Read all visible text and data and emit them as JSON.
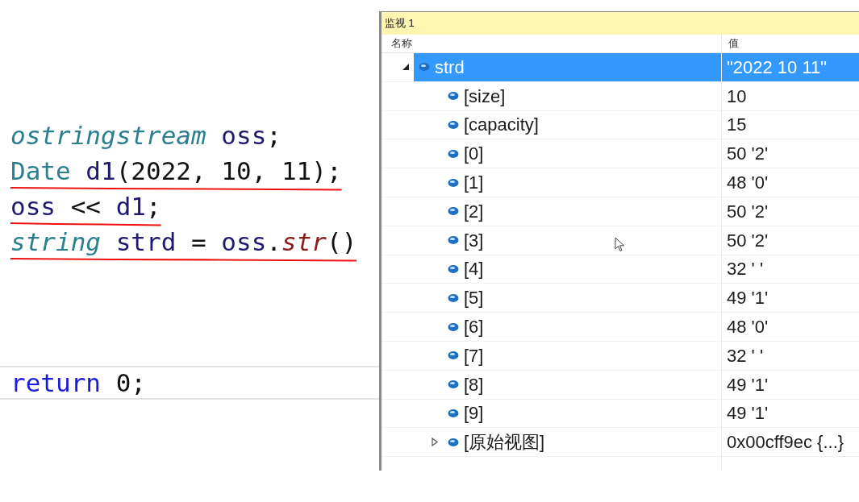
{
  "code_lines": [
    {
      "underlined": false,
      "current": false,
      "tokens": [
        {
          "kind": "type",
          "text": "ostringstream"
        },
        {
          "kind": "variable",
          "text": " oss"
        },
        {
          "kind": "punct",
          "text": ";"
        }
      ]
    },
    {
      "underlined": true,
      "current": false,
      "tokens": [
        {
          "kind": "class",
          "text": "Date"
        },
        {
          "kind": "variable",
          "text": " d1"
        },
        {
          "kind": "punct",
          "text": "(2022, 10, 11);"
        }
      ]
    },
    {
      "underlined": true,
      "current": false,
      "tokens": [
        {
          "kind": "variable",
          "text": "oss"
        },
        {
          "kind": "punct",
          "text": " << "
        },
        {
          "kind": "variable",
          "text": "d1"
        },
        {
          "kind": "punct",
          "text": ";"
        }
      ]
    },
    {
      "underlined": true,
      "current": false,
      "tokens": [
        {
          "kind": "type",
          "text": "string"
        },
        {
          "kind": "variable",
          "text": " strd"
        },
        {
          "kind": "punct",
          "text": " = "
        },
        {
          "kind": "variable",
          "text": "oss"
        },
        {
          "kind": "punct",
          "text": "."
        },
        {
          "kind": "method",
          "text": "str"
        },
        {
          "kind": "punct",
          "text": "()"
        }
      ]
    },
    {
      "underlined": false,
      "current": true,
      "tokens": [
        {
          "kind": "keyword",
          "text": "return"
        },
        {
          "kind": "punct",
          "text": " 0;"
        }
      ]
    }
  ],
  "watch": {
    "title": "监视 1",
    "columns": [
      "名称",
      "值"
    ],
    "items": [
      {
        "name": "strd",
        "value": "\"2022 10 11\"",
        "selected": true,
        "expanded": true,
        "children": [
          {
            "name": "[size]",
            "value": "10",
            "selected": false
          },
          {
            "name": "[capacity]",
            "value": "15",
            "selected": false
          },
          {
            "name": "[0]",
            "value": "50 '2'",
            "selected": false
          },
          {
            "name": "[1]",
            "value": "48 '0'",
            "selected": false
          },
          {
            "name": "[2]",
            "value": "50 '2'",
            "selected": false
          },
          {
            "name": "[3]",
            "value": "50 '2'",
            "selected": false
          },
          {
            "name": "[4]",
            "value": "32 ' '",
            "selected": false
          },
          {
            "name": "[5]",
            "value": "49 '1'",
            "selected": false
          },
          {
            "name": "[6]",
            "value": "48 '0'",
            "selected": false
          },
          {
            "name": "[7]",
            "value": "32 ' '",
            "selected": false
          },
          {
            "name": "[8]",
            "value": "49 '1'",
            "selected": false
          },
          {
            "name": "[9]",
            "value": "49 '1'",
            "selected": false
          },
          {
            "name": "[原始视图]",
            "value": "0x00cff9ec {...}",
            "selected": false,
            "expanded": false
          }
        ]
      }
    ]
  }
}
